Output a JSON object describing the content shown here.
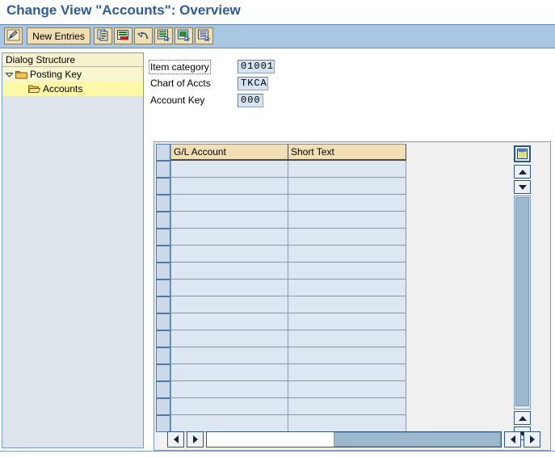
{
  "window": {
    "title": "Change View \"Accounts\": Overview"
  },
  "toolbar": {
    "buttons": [
      {
        "name": "display-change",
        "icon": "pencil-icon",
        "label": ""
      },
      {
        "name": "new-entries",
        "icon": "",
        "label": "New Entries"
      },
      {
        "name": "copy-as",
        "icon": "copy-icon",
        "label": ""
      },
      {
        "name": "delete",
        "icon": "delete-icon",
        "label": ""
      },
      {
        "name": "undo",
        "icon": "undo-icon",
        "label": ""
      },
      {
        "name": "select-all",
        "icon": "select-all-icon",
        "label": ""
      },
      {
        "name": "deselect-all",
        "icon": "deselect-all-icon",
        "label": ""
      },
      {
        "name": "details",
        "icon": "details-icon",
        "label": ""
      }
    ],
    "new_entries_label": "New Entries"
  },
  "tree": {
    "header": "Dialog Structure",
    "items": [
      {
        "label": "Posting Key",
        "icon": "folder-icon",
        "expanded": true,
        "selected": false
      },
      {
        "label": "Accounts",
        "icon": "folder-open-icon",
        "expanded": false,
        "selected": true
      }
    ]
  },
  "fields": [
    {
      "label": "Item category",
      "value": "01001",
      "focused": true
    },
    {
      "label": "Chart of Accts",
      "value": "TKCA",
      "focused": false
    },
    {
      "label": "Account Key",
      "value": "000",
      "focused": false
    }
  ],
  "table": {
    "columns": [
      "G/L Account",
      "Short Text"
    ],
    "rows": [
      [
        "",
        ""
      ],
      [
        "",
        ""
      ],
      [
        "",
        ""
      ],
      [
        "",
        ""
      ],
      [
        "",
        ""
      ],
      [
        "",
        ""
      ],
      [
        "",
        ""
      ],
      [
        "",
        ""
      ],
      [
        "",
        ""
      ],
      [
        "",
        ""
      ],
      [
        "",
        ""
      ],
      [
        "",
        ""
      ],
      [
        "",
        ""
      ],
      [
        "",
        ""
      ],
      [
        "",
        ""
      ],
      [
        "",
        ""
      ]
    ],
    "settings_icon": "table-settings-icon",
    "vertical_scroll": {
      "page_up_icon": "scroll-page-up-icon",
      "page_down_icon": "scroll-page-down-icon",
      "up_icon": "scroll-up-icon",
      "down_icon": "scroll-down-icon"
    },
    "horizontal_scroll": {
      "first_icon": "scroll-first-icon",
      "prev_icon": "scroll-prev-icon",
      "next_icon": "scroll-next-icon",
      "last_icon": "scroll-last-icon"
    }
  },
  "colors": {
    "title": "#2b5c9e",
    "toolbar_bg": "#a9c6e3",
    "button_bg": "#f1dfb4",
    "tree_bg": "#dde4ec",
    "tree_selected": "#fbf8a8",
    "field_bg": "#d5e2f0",
    "header_cell": "#f0dfb4",
    "data_cell": "#dde7f2",
    "scroll_thumb": "#9cb8cd"
  }
}
